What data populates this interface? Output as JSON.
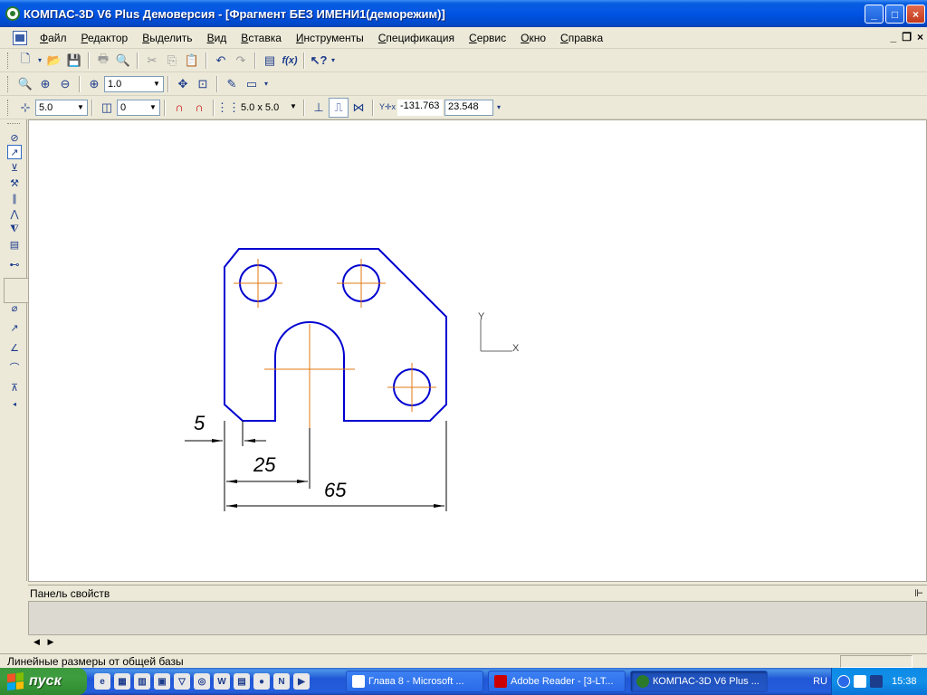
{
  "window": {
    "title": "КОМПАС-3D V6 Plus Демоверсия - [Фрагмент БЕЗ ИМЕНИ1(деморежим)]",
    "min_label": "_",
    "max_label": "□",
    "close_label": "×"
  },
  "menu": [
    "Файл",
    "Редактор",
    "Выделить",
    "Вид",
    "Вставка",
    "Инструменты",
    "Спецификация",
    "Сервис",
    "Окно",
    "Справка"
  ],
  "mdi": {
    "min": "_",
    "restore": "❐",
    "close": "×"
  },
  "toolbar2": {
    "zoom_value": "1.0"
  },
  "toolbar3": {
    "step_value": "5.0",
    "layer_value": "0",
    "grid_value": "5.0 x 5.0",
    "coord_x": "-131.763",
    "coord_y": "23.548"
  },
  "drawing": {
    "dim_5": "5",
    "dim_25": "25",
    "dim_65": "65",
    "axis_y": "Y",
    "axis_x": "X"
  },
  "props": {
    "title": "Панель свойств",
    "pin": "ꟸ"
  },
  "status": {
    "text": "Линейные размеры от общей базы"
  },
  "taskbar": {
    "start_label": "пуск",
    "tasks": [
      {
        "label": "Глава 8 - Microsoft ..."
      },
      {
        "label": "Adobe Reader - [3-LT..."
      },
      {
        "label": "КОМПАС-3D V6 Plus ..."
      }
    ],
    "lang": "RU",
    "time": "15:38"
  },
  "colors": {
    "contour": "#0000d0",
    "axis": "#e07a10",
    "dimension": "#000000"
  }
}
